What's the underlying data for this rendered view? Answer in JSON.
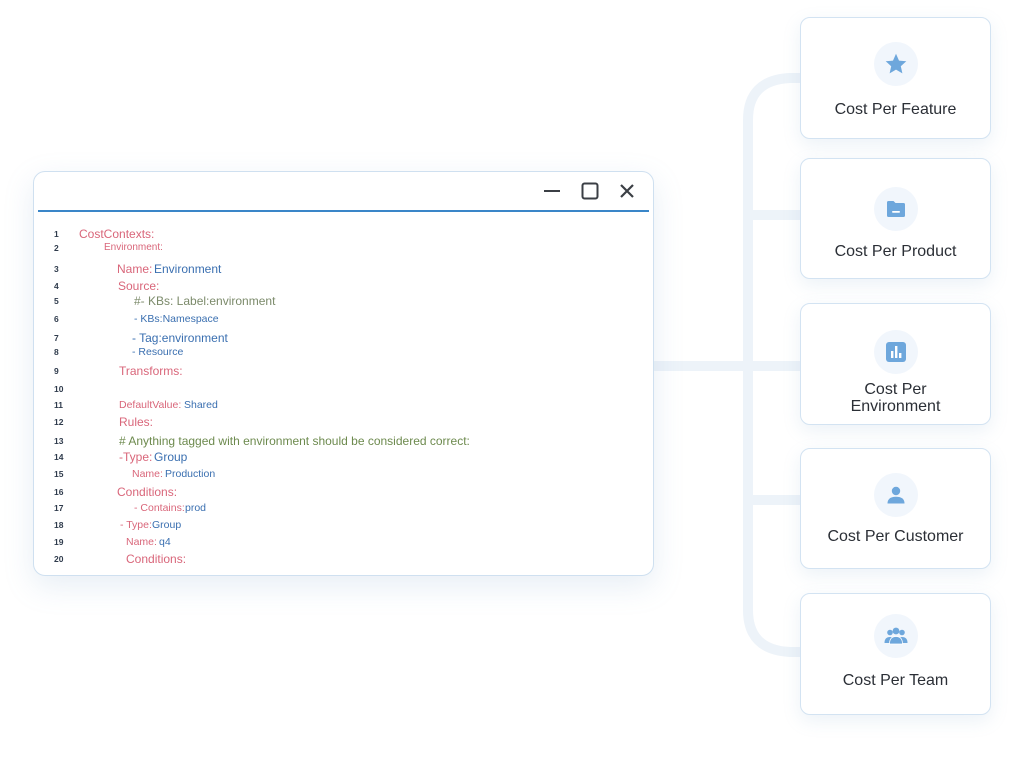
{
  "window": {
    "minimize_icon": "minimize-icon",
    "maximize_icon": "maximize-icon",
    "close_icon": "close-icon"
  },
  "code_lines": [
    {
      "n": "1",
      "t1": "CostContexts:",
      "t2": ""
    },
    {
      "n": "2",
      "t1": "Environment:",
      "t2": ""
    },
    {
      "n": "3",
      "t1": "Name:",
      "t2": "Environment"
    },
    {
      "n": "4",
      "t1": "Source:",
      "t2": ""
    },
    {
      "n": "5",
      "t1": "#- KBs: Label:environment",
      "t2": ""
    },
    {
      "n": "6",
      "t1": "- KBs:Namespace",
      "t2": ""
    },
    {
      "n": "7",
      "t1": "- Tag:environment",
      "t2": ""
    },
    {
      "n": "8",
      "t1": "- Resource",
      "t2": ""
    },
    {
      "n": "9",
      "t1": "Transforms:",
      "t2": ""
    },
    {
      "n": "10",
      "t1": "",
      "t2": ""
    },
    {
      "n": "11",
      "t1": "DefaultValue:",
      "t2": "Shared"
    },
    {
      "n": "12",
      "t1": "Rules:",
      "t2": ""
    },
    {
      "n": "13",
      "t1": "# Anything tagged with environment should be considered correct:",
      "t2": ""
    },
    {
      "n": "14",
      "t1": "-Type:",
      "t2": "Group"
    },
    {
      "n": "15",
      "t1": "Name:",
      "t2": "Production"
    },
    {
      "n": "16",
      "t1": "Conditions:",
      "t2": ""
    },
    {
      "n": "17",
      "t1": "- Contains:",
      "t2": "prod"
    },
    {
      "n": "18",
      "t1": "- Type:",
      "t2": "Group"
    },
    {
      "n": "19",
      "t1": "Name:",
      "t2": "q4"
    },
    {
      "n": "20",
      "t1": "Conditions:",
      "t2": ""
    }
  ],
  "cards": [
    {
      "label": "Cost Per Feature",
      "icon": "star-icon"
    },
    {
      "label": "Cost Per Product",
      "icon": "folder-icon"
    },
    {
      "label_line1": "Cost Per",
      "label_line2": "Environment",
      "icon": "bar-chart-icon"
    },
    {
      "label": "Cost Per Customer",
      "icon": "person-icon"
    },
    {
      "label": "Cost Per Team",
      "icon": "team-icon"
    }
  ],
  "colors": {
    "accent": "#3a86c8",
    "icon": "#6ea7dc",
    "keyword": "#d9667a",
    "value": "#3a6fb0"
  }
}
